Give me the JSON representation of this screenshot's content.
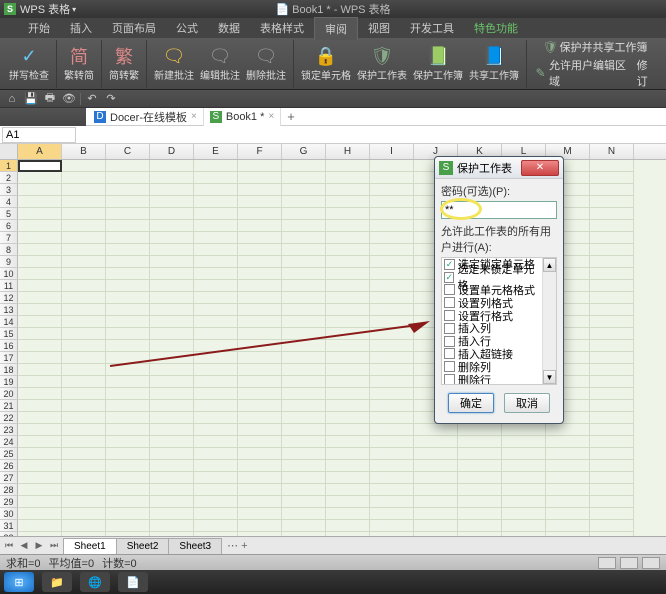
{
  "app": {
    "icon_letter": "S",
    "title": "WPS 表格",
    "center_title": "Book1 * - WPS 表格"
  },
  "menus": [
    "开始",
    "插入",
    "页面布局",
    "公式",
    "数据",
    "表格样式",
    "审阅",
    "视图",
    "开发工具",
    "特色功能"
  ],
  "active_menu": 6,
  "special_menu": 9,
  "ribbon": {
    "spellcheck": "拼写检查",
    "s2t": "繁转简",
    "t2s": "简转繁",
    "new_comment": "新建批注",
    "edit_comment": "编辑批注",
    "del_comment": "删除批注",
    "lock_cell": "锁定单元格",
    "protect_sheet": "保护工作表",
    "protect_book": "保护工作簿",
    "share_book": "共享工作簿",
    "protect_share": "保护并共享工作簿",
    "allow_edit": "允许用户编辑区域",
    "revisions": "修订"
  },
  "doc_tabs": [
    {
      "icon": "D",
      "label": "Docer-在线模板",
      "active": false,
      "color": "#2a74d4"
    },
    {
      "icon": "S",
      "label": "Book1 *",
      "active": true,
      "color": "#4aa04a"
    }
  ],
  "namebox": "A1",
  "columns": [
    "A",
    "B",
    "C",
    "D",
    "E",
    "F",
    "G",
    "H",
    "I",
    "J",
    "K",
    "L",
    "M",
    "N"
  ],
  "row_count": 32,
  "sheets": [
    "Sheet1",
    "Sheet2",
    "Sheet3"
  ],
  "active_sheet": 0,
  "status": {
    "sum": "求和=0",
    "avg": "平均值=0",
    "count": "计数=0"
  },
  "dialog": {
    "title": "保护工作表",
    "pwd_label": "密码(可选)(P):",
    "pwd_value": "**",
    "allow_label": "允许此工作表的所有用户进行(A):",
    "items": [
      {
        "label": "选定锁定单元格",
        "checked": true
      },
      {
        "label": "选定未锁定单元格",
        "checked": true
      },
      {
        "label": "设置单元格格式",
        "checked": false
      },
      {
        "label": "设置列格式",
        "checked": false
      },
      {
        "label": "设置行格式",
        "checked": false
      },
      {
        "label": "插入列",
        "checked": false
      },
      {
        "label": "插入行",
        "checked": false
      },
      {
        "label": "插入超链接",
        "checked": false
      },
      {
        "label": "删除列",
        "checked": false
      },
      {
        "label": "删除行",
        "checked": false
      }
    ],
    "ok": "确定",
    "cancel": "取消"
  }
}
